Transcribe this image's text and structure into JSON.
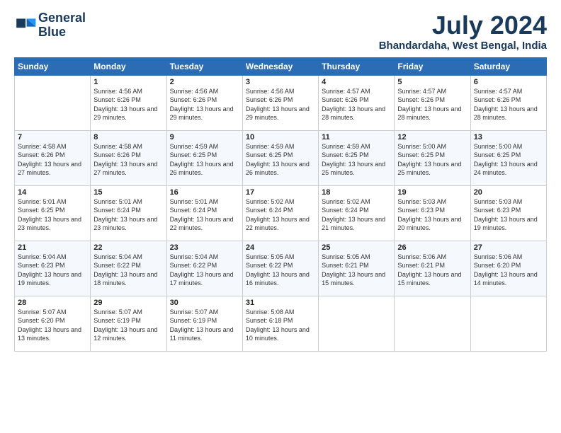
{
  "logo": {
    "line1": "General",
    "line2": "Blue"
  },
  "title": "July 2024",
  "location": "Bhandardaha, West Bengal, India",
  "headers": [
    "Sunday",
    "Monday",
    "Tuesday",
    "Wednesday",
    "Thursday",
    "Friday",
    "Saturday"
  ],
  "weeks": [
    [
      {
        "day": "",
        "sunrise": "",
        "sunset": "",
        "daylight": ""
      },
      {
        "day": "1",
        "sunrise": "Sunrise: 4:56 AM",
        "sunset": "Sunset: 6:26 PM",
        "daylight": "Daylight: 13 hours and 29 minutes."
      },
      {
        "day": "2",
        "sunrise": "Sunrise: 4:56 AM",
        "sunset": "Sunset: 6:26 PM",
        "daylight": "Daylight: 13 hours and 29 minutes."
      },
      {
        "day": "3",
        "sunrise": "Sunrise: 4:56 AM",
        "sunset": "Sunset: 6:26 PM",
        "daylight": "Daylight: 13 hours and 29 minutes."
      },
      {
        "day": "4",
        "sunrise": "Sunrise: 4:57 AM",
        "sunset": "Sunset: 6:26 PM",
        "daylight": "Daylight: 13 hours and 28 minutes."
      },
      {
        "day": "5",
        "sunrise": "Sunrise: 4:57 AM",
        "sunset": "Sunset: 6:26 PM",
        "daylight": "Daylight: 13 hours and 28 minutes."
      },
      {
        "day": "6",
        "sunrise": "Sunrise: 4:57 AM",
        "sunset": "Sunset: 6:26 PM",
        "daylight": "Daylight: 13 hours and 28 minutes."
      }
    ],
    [
      {
        "day": "7",
        "sunrise": "Sunrise: 4:58 AM",
        "sunset": "Sunset: 6:26 PM",
        "daylight": "Daylight: 13 hours and 27 minutes."
      },
      {
        "day": "8",
        "sunrise": "Sunrise: 4:58 AM",
        "sunset": "Sunset: 6:26 PM",
        "daylight": "Daylight: 13 hours and 27 minutes."
      },
      {
        "day": "9",
        "sunrise": "Sunrise: 4:59 AM",
        "sunset": "Sunset: 6:25 PM",
        "daylight": "Daylight: 13 hours and 26 minutes."
      },
      {
        "day": "10",
        "sunrise": "Sunrise: 4:59 AM",
        "sunset": "Sunset: 6:25 PM",
        "daylight": "Daylight: 13 hours and 26 minutes."
      },
      {
        "day": "11",
        "sunrise": "Sunrise: 4:59 AM",
        "sunset": "Sunset: 6:25 PM",
        "daylight": "Daylight: 13 hours and 25 minutes."
      },
      {
        "day": "12",
        "sunrise": "Sunrise: 5:00 AM",
        "sunset": "Sunset: 6:25 PM",
        "daylight": "Daylight: 13 hours and 25 minutes."
      },
      {
        "day": "13",
        "sunrise": "Sunrise: 5:00 AM",
        "sunset": "Sunset: 6:25 PM",
        "daylight": "Daylight: 13 hours and 24 minutes."
      }
    ],
    [
      {
        "day": "14",
        "sunrise": "Sunrise: 5:01 AM",
        "sunset": "Sunset: 6:25 PM",
        "daylight": "Daylight: 13 hours and 23 minutes."
      },
      {
        "day": "15",
        "sunrise": "Sunrise: 5:01 AM",
        "sunset": "Sunset: 6:24 PM",
        "daylight": "Daylight: 13 hours and 23 minutes."
      },
      {
        "day": "16",
        "sunrise": "Sunrise: 5:01 AM",
        "sunset": "Sunset: 6:24 PM",
        "daylight": "Daylight: 13 hours and 22 minutes."
      },
      {
        "day": "17",
        "sunrise": "Sunrise: 5:02 AM",
        "sunset": "Sunset: 6:24 PM",
        "daylight": "Daylight: 13 hours and 22 minutes."
      },
      {
        "day": "18",
        "sunrise": "Sunrise: 5:02 AM",
        "sunset": "Sunset: 6:24 PM",
        "daylight": "Daylight: 13 hours and 21 minutes."
      },
      {
        "day": "19",
        "sunrise": "Sunrise: 5:03 AM",
        "sunset": "Sunset: 6:23 PM",
        "daylight": "Daylight: 13 hours and 20 minutes."
      },
      {
        "day": "20",
        "sunrise": "Sunrise: 5:03 AM",
        "sunset": "Sunset: 6:23 PM",
        "daylight": "Daylight: 13 hours and 19 minutes."
      }
    ],
    [
      {
        "day": "21",
        "sunrise": "Sunrise: 5:04 AM",
        "sunset": "Sunset: 6:23 PM",
        "daylight": "Daylight: 13 hours and 19 minutes."
      },
      {
        "day": "22",
        "sunrise": "Sunrise: 5:04 AM",
        "sunset": "Sunset: 6:22 PM",
        "daylight": "Daylight: 13 hours and 18 minutes."
      },
      {
        "day": "23",
        "sunrise": "Sunrise: 5:04 AM",
        "sunset": "Sunset: 6:22 PM",
        "daylight": "Daylight: 13 hours and 17 minutes."
      },
      {
        "day": "24",
        "sunrise": "Sunrise: 5:05 AM",
        "sunset": "Sunset: 6:22 PM",
        "daylight": "Daylight: 13 hours and 16 minutes."
      },
      {
        "day": "25",
        "sunrise": "Sunrise: 5:05 AM",
        "sunset": "Sunset: 6:21 PM",
        "daylight": "Daylight: 13 hours and 15 minutes."
      },
      {
        "day": "26",
        "sunrise": "Sunrise: 5:06 AM",
        "sunset": "Sunset: 6:21 PM",
        "daylight": "Daylight: 13 hours and 15 minutes."
      },
      {
        "day": "27",
        "sunrise": "Sunrise: 5:06 AM",
        "sunset": "Sunset: 6:20 PM",
        "daylight": "Daylight: 13 hours and 14 minutes."
      }
    ],
    [
      {
        "day": "28",
        "sunrise": "Sunrise: 5:07 AM",
        "sunset": "Sunset: 6:20 PM",
        "daylight": "Daylight: 13 hours and 13 minutes."
      },
      {
        "day": "29",
        "sunrise": "Sunrise: 5:07 AM",
        "sunset": "Sunset: 6:19 PM",
        "daylight": "Daylight: 13 hours and 12 minutes."
      },
      {
        "day": "30",
        "sunrise": "Sunrise: 5:07 AM",
        "sunset": "Sunset: 6:19 PM",
        "daylight": "Daylight: 13 hours and 11 minutes."
      },
      {
        "day": "31",
        "sunrise": "Sunrise: 5:08 AM",
        "sunset": "Sunset: 6:18 PM",
        "daylight": "Daylight: 13 hours and 10 minutes."
      },
      {
        "day": "",
        "sunrise": "",
        "sunset": "",
        "daylight": ""
      },
      {
        "day": "",
        "sunrise": "",
        "sunset": "",
        "daylight": ""
      },
      {
        "day": "",
        "sunrise": "",
        "sunset": "",
        "daylight": ""
      }
    ]
  ]
}
